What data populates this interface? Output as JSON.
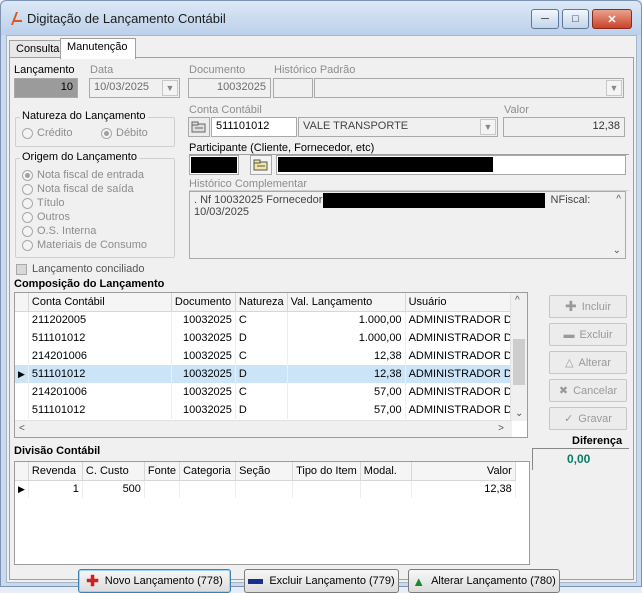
{
  "window": {
    "title": "Digitação de Lançamento Contábil"
  },
  "tabs": [
    {
      "label": "Consulta"
    },
    {
      "label": "Manutenção"
    }
  ],
  "form": {
    "lancamento_label": "Lançamento",
    "lancamento_value": "10",
    "data_label": "Data",
    "data_value": "10/03/2025",
    "documento_label": "Documento",
    "documento_value": "10032025",
    "historico_padrao_label": "Histórico Padrão",
    "conta_contabil_label": "Conta Contábil",
    "conta_contabil_code": "511101012",
    "conta_contabil_desc": "VALE TRANSPORTE",
    "valor_label": "Valor",
    "valor_value": "12,38",
    "participante_label": "Participante (Cliente, Fornecedor, etc)",
    "historico_complementar_label": "Histórico Complementar",
    "historico_text_1": ". Nf 10032025 Fornecedor",
    "historico_text_2": "NFiscal:",
    "historico_text_3": "10/03/2025"
  },
  "natureza": {
    "title": "Natureza do Lançamento",
    "options": [
      {
        "label": "Crédito",
        "checked": false
      },
      {
        "label": "Débito",
        "checked": true
      }
    ]
  },
  "origem": {
    "title": "Origem do Lançamento",
    "options": [
      {
        "label": "Nota fiscal de entrada",
        "checked": true
      },
      {
        "label": "Nota fiscal de saída",
        "checked": false
      },
      {
        "label": "Título",
        "checked": false
      },
      {
        "label": "Outros",
        "checked": false
      },
      {
        "label": "O.S. Interna",
        "checked": false
      },
      {
        "label": "Materiais de Consumo",
        "checked": false
      }
    ]
  },
  "conciliado_label": "Lançamento conciliado",
  "composicao": {
    "title": "Composição do Lançamento",
    "columns": [
      "Conta Contábil",
      "Documento",
      "Natureza",
      "Val. Lançamento",
      "Usuário"
    ],
    "rows": [
      {
        "conta": "211202005",
        "documento": "10032025",
        "natureza": "C",
        "valor": "1.000,00",
        "usuario": "ADMINISTRADOR DC"
      },
      {
        "conta": "511101012",
        "documento": "10032025",
        "natureza": "D",
        "valor": "1.000,00",
        "usuario": "ADMINISTRADOR DC"
      },
      {
        "conta": "214201006",
        "documento": "10032025",
        "natureza": "C",
        "valor": "12,38",
        "usuario": "ADMINISTRADOR DC"
      },
      {
        "conta": "511101012",
        "documento": "10032025",
        "natureza": "D",
        "valor": "12,38",
        "usuario": "ADMINISTRADOR DC"
      },
      {
        "conta": "214201006",
        "documento": "10032025",
        "natureza": "C",
        "valor": "57,00",
        "usuario": "ADMINISTRADOR DC"
      },
      {
        "conta": "511101012",
        "documento": "10032025",
        "natureza": "D",
        "valor": "57,00",
        "usuario": "ADMINISTRADOR DC"
      }
    ],
    "selected_row": 3
  },
  "side_buttons": {
    "incluir": "Incluir",
    "excluir": "Excluir",
    "alterar": "Alterar",
    "cancelar": "Cancelar",
    "gravar": "Gravar"
  },
  "diferenca": {
    "label": "Diferença",
    "value": "0,00"
  },
  "divisao": {
    "title": "Divisão Contábil",
    "columns": [
      "Revenda",
      "C. Custo",
      "Fonte",
      "Categoria",
      "Seção",
      "Tipo do Item",
      "Modal.",
      "Valor"
    ],
    "rows": [
      {
        "revenda": "1",
        "ccusto": "500",
        "fonte": "",
        "categoria": "",
        "secao": "",
        "tipo": "",
        "modal": "",
        "valor": "12,38"
      }
    ]
  },
  "bottom_buttons": {
    "novo": "Novo Lançamento (778)",
    "excluir": "Excluir Lançamento (779)",
    "alterar": "Alterar Lançamento (780)"
  },
  "colors": {
    "accent_green": "#0b7a67",
    "selection": "#cce4f7",
    "novo_icon": "#d21f1f",
    "excluir_icon": "#1a2f8a",
    "alterar_icon": "#188a2c"
  }
}
